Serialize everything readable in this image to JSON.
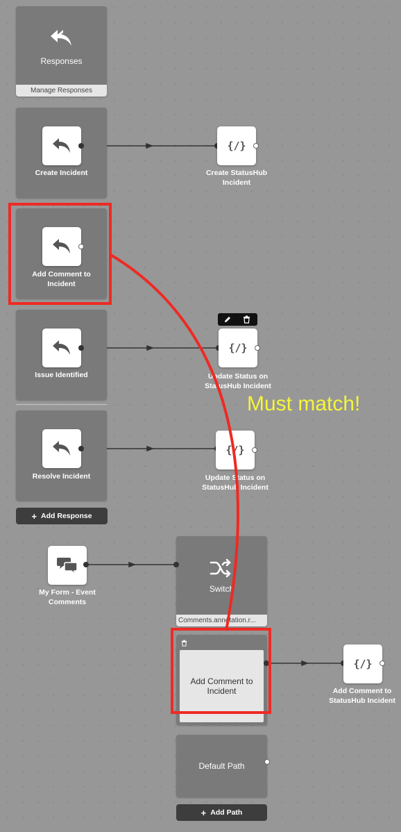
{
  "responses": {
    "title": "Responses",
    "manage_label": "Manage Responses",
    "items": [
      {
        "label": "Create Incident"
      },
      {
        "label": "Add Comment to Incident"
      },
      {
        "label": "Issue Identified"
      },
      {
        "label": "Resolve Incident"
      }
    ],
    "add_label": "Add Response",
    "add_plus": "+"
  },
  "actions": [
    {
      "label": "Create StatusHub Incident",
      "icon": "{/}"
    },
    {
      "label": "Update Status on StatusHub Incident",
      "icon": "{/}"
    },
    {
      "label": "Update Status on StatusHub Incident",
      "icon": "{/}"
    },
    {
      "label": "Add Comment to StatusHub Incident",
      "icon": "{/}"
    }
  ],
  "trigger": {
    "label": "My Form - Event Comments"
  },
  "switch_node": {
    "title": "Switch",
    "expression": "Comments.annotation.r...",
    "paths": [
      {
        "label": "Add Comment to Incident"
      }
    ],
    "default_label": "Default Path",
    "add_path_label": "Add Path",
    "add_plus": "+"
  },
  "annotation": {
    "text": "Must match!",
    "text_color": "#f5f53a",
    "highlight_color": "#ee2a24"
  },
  "colors": {
    "canvas": "#979797",
    "panel": "#7a7a7a",
    "button": "#3d3d3d"
  }
}
